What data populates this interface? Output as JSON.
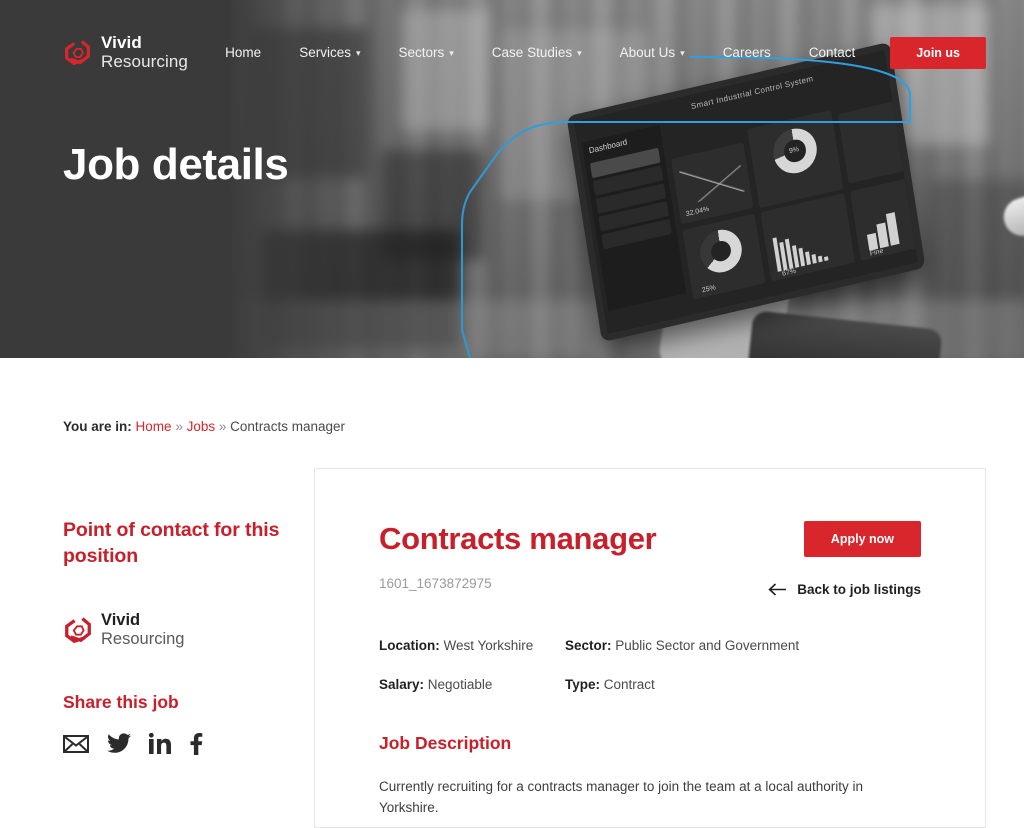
{
  "brand": {
    "line1": "Vivid",
    "line2": "Resourcing",
    "logo_icon": "vivid-hex-spiral-logo"
  },
  "nav": {
    "items": [
      {
        "label": "Home",
        "has_caret": false
      },
      {
        "label": "Services",
        "has_caret": true
      },
      {
        "label": "Sectors",
        "has_caret": true
      },
      {
        "label": "Case Studies",
        "has_caret": true
      },
      {
        "label": "About Us",
        "has_caret": true
      },
      {
        "label": "Careers",
        "has_caret": false
      },
      {
        "label": "Contact",
        "has_caret": false
      }
    ],
    "cta_label": "Join us"
  },
  "hero": {
    "title": "Job details"
  },
  "breadcrumb": {
    "label": "You are in:",
    "home": "Home",
    "sep": "»",
    "jobs": "Jobs",
    "current": "Contracts manager"
  },
  "sidebar": {
    "contact_heading": "Point of contact for this position",
    "share_heading": "Share this job",
    "socials": [
      {
        "name": "email-icon",
        "title": "Email"
      },
      {
        "name": "twitter-icon",
        "title": "Twitter"
      },
      {
        "name": "linkedin-icon",
        "title": "LinkedIn"
      },
      {
        "name": "facebook-icon",
        "title": "Facebook"
      }
    ]
  },
  "job": {
    "title": "Contracts manager",
    "reference": "1601_1673872975",
    "apply_label": "Apply now",
    "back_label": "Back to job listings",
    "meta": {
      "location_label": "Location:",
      "location_value": "West Yorkshire",
      "sector_label": "Sector:",
      "sector_value": "Public Sector and Government",
      "salary_label": "Salary:",
      "salary_value": "Negotiable",
      "type_label": "Type:",
      "type_value": "Contract"
    },
    "description_heading": "Job Description",
    "description_body": "Currently recruiting for a contracts manager to join the team at a local authority in Yorkshire."
  },
  "tablet": {
    "title": "Smart Industrial Control System",
    "dashboard_label": "Dashboard",
    "stat1": "32.04%",
    "stat2": "25%",
    "stat3": "67%",
    "stat4": "Fine",
    "stat5": "9%"
  },
  "colors": {
    "brand_red": "#d8262c",
    "heading_red": "#c8202a",
    "hero_dark": "#3a3a3a",
    "accent_blue": "#2f9fe0",
    "card_border": "#e6e6e6"
  }
}
